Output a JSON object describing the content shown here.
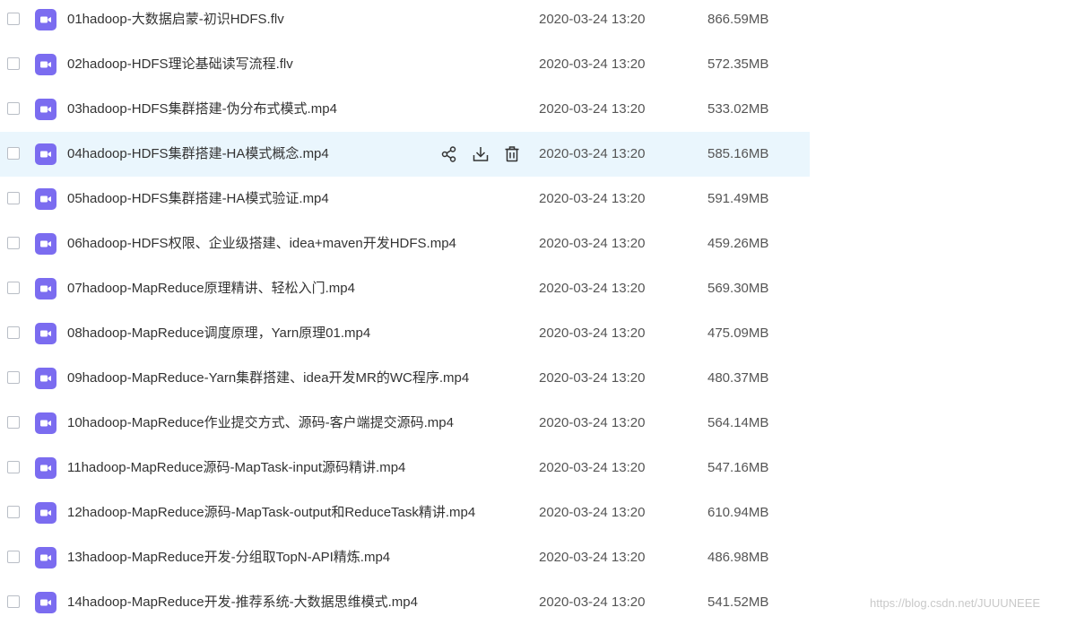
{
  "files": [
    {
      "name": "01hadoop-大数据启蒙-初识HDFS.flv",
      "date": "2020-03-24 13:20",
      "size": "866.59MB"
    },
    {
      "name": "02hadoop-HDFS理论基础读写流程.flv",
      "date": "2020-03-24 13:20",
      "size": "572.35MB"
    },
    {
      "name": "03hadoop-HDFS集群搭建-伪分布式模式.mp4",
      "date": "2020-03-24 13:20",
      "size": "533.02MB"
    },
    {
      "name": "04hadoop-HDFS集群搭建-HA模式概念.mp4",
      "date": "2020-03-24 13:20",
      "size": "585.16MB"
    },
    {
      "name": "05hadoop-HDFS集群搭建-HA模式验证.mp4",
      "date": "2020-03-24 13:20",
      "size": "591.49MB"
    },
    {
      "name": "06hadoop-HDFS权限、企业级搭建、idea+maven开发HDFS.mp4",
      "date": "2020-03-24 13:20",
      "size": "459.26MB"
    },
    {
      "name": "07hadoop-MapReduce原理精讲、轻松入门.mp4",
      "date": "2020-03-24 13:20",
      "size": "569.30MB"
    },
    {
      "name": "08hadoop-MapReduce调度原理，Yarn原理01.mp4",
      "date": "2020-03-24 13:20",
      "size": "475.09MB"
    },
    {
      "name": "09hadoop-MapReduce-Yarn集群搭建、idea开发MR的WC程序.mp4",
      "date": "2020-03-24 13:20",
      "size": "480.37MB"
    },
    {
      "name": "10hadoop-MapReduce作业提交方式、源码-客户端提交源码.mp4",
      "date": "2020-03-24 13:20",
      "size": "564.14MB"
    },
    {
      "name": "11hadoop-MapReduce源码-MapTask-input源码精讲.mp4",
      "date": "2020-03-24 13:20",
      "size": "547.16MB"
    },
    {
      "name": "12hadoop-MapReduce源码-MapTask-output和ReduceTask精讲.mp4",
      "date": "2020-03-24 13:20",
      "size": "610.94MB"
    },
    {
      "name": "13hadoop-MapReduce开发-分组取TopN-API精炼.mp4",
      "date": "2020-03-24 13:20",
      "size": "486.98MB"
    },
    {
      "name": "14hadoop-MapReduce开发-推荐系统-大数据思维模式.mp4",
      "date": "2020-03-24 13:20",
      "size": "541.52MB"
    }
  ],
  "hover_row_index": 3,
  "icons": {
    "file": "video-file-icon",
    "share": "share-icon",
    "download": "download-icon",
    "delete": "trash-icon"
  },
  "colors": {
    "accent": "#7b6cf0",
    "hover_bg": "#eaf6fd"
  },
  "watermark": "https://blog.csdn.net/JUUUNEEE"
}
